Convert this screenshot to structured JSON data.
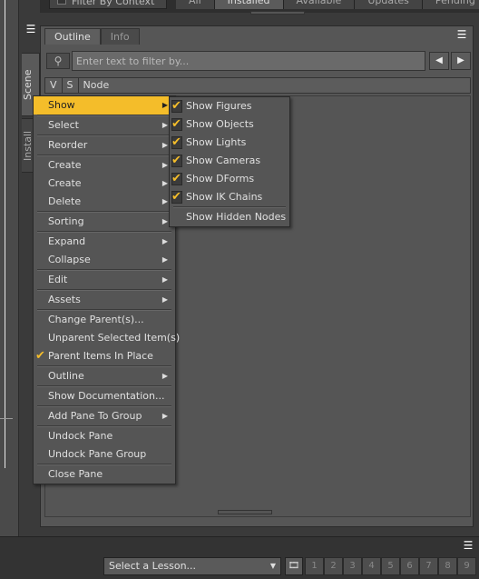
{
  "top_bar": {
    "filter_label": "Filter By Context",
    "tabs": [
      {
        "label": "All"
      },
      {
        "label": "Installed"
      },
      {
        "label": "Available"
      },
      {
        "label": "Updates"
      },
      {
        "label": "Pending"
      }
    ]
  },
  "side_tabs": {
    "scene": "Scene",
    "install": "Install"
  },
  "panel": {
    "tabs": [
      {
        "label": "Outline"
      },
      {
        "label": "Info"
      }
    ],
    "search_placeholder": "Enter text to filter by...",
    "columns": {
      "v": "V",
      "s": "S",
      "node": "Node"
    }
  },
  "context_menu": {
    "items": [
      {
        "label": "Show",
        "arrow": true
      },
      {
        "label": "Select",
        "arrow": true
      },
      {
        "label": "Reorder",
        "arrow": true
      },
      {
        "label": "Create",
        "arrow": true
      },
      {
        "label": "Create",
        "arrow": true
      },
      {
        "label": "Delete",
        "arrow": true
      },
      {
        "label": "Sorting",
        "arrow": true
      },
      {
        "label": "Expand",
        "arrow": true
      },
      {
        "label": "Collapse",
        "arrow": true
      },
      {
        "label": "Edit",
        "arrow": true
      },
      {
        "label": "Assets",
        "arrow": true
      },
      {
        "label": "Change Parent(s)..."
      },
      {
        "label": "Unparent Selected Item(s)"
      },
      {
        "label": "Parent Items In Place",
        "checked": true
      },
      {
        "label": "Outline",
        "arrow": true
      },
      {
        "label": "Show Documentation..."
      },
      {
        "label": "Add Pane To Group",
        "arrow": true
      },
      {
        "label": "Undock Pane"
      },
      {
        "label": "Undock Pane Group"
      },
      {
        "label": "Close Pane"
      }
    ]
  },
  "submenu": {
    "items": [
      {
        "label": "Show Figures",
        "checked": true
      },
      {
        "label": "Show Objects",
        "checked": true
      },
      {
        "label": "Show Lights",
        "checked": true
      },
      {
        "label": "Show Cameras",
        "checked": true
      },
      {
        "label": "Show DForms",
        "checked": true
      },
      {
        "label": "Show IK Chains",
        "checked": true
      },
      {
        "label": "Show Hidden Nodes",
        "checked": false
      }
    ]
  },
  "bottom_bar": {
    "lesson_select": "Select a Lesson...",
    "pages": [
      "1",
      "2",
      "3",
      "4",
      "5",
      "6",
      "7",
      "8",
      "9"
    ]
  },
  "colors": {
    "highlight": "#f4bd2a",
    "panel_bg": "#565656",
    "menu_bg": "#555555"
  }
}
